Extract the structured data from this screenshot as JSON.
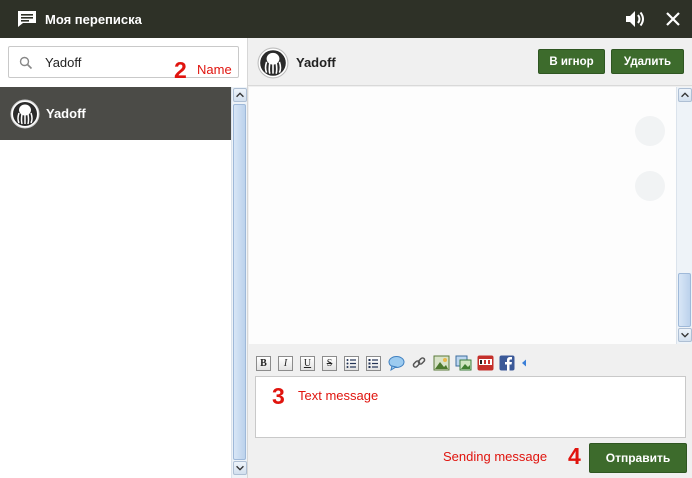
{
  "titlebar": {
    "title": "Моя переписка",
    "icons": [
      "chat-icon",
      "speaker-icon",
      "close-icon"
    ]
  },
  "search": {
    "value": "Yadoff"
  },
  "annotations": {
    "name_num": "2",
    "name_text": "Name",
    "text_num": "3",
    "text_text": "Text message",
    "send_num": "4",
    "send_text": "Sending message"
  },
  "contacts": [
    {
      "name": "Yadoff",
      "selected": true
    }
  ],
  "conversation": {
    "name": "Yadoff",
    "ignore_label": "В игнор",
    "delete_label": "Удалить",
    "send_label": "Отправить"
  },
  "toolbar": {
    "bold": "B",
    "italic": "I",
    "underline": "U",
    "strike": "S",
    "items": [
      "bold-icon",
      "italic-icon",
      "underline-icon",
      "strikethrough-icon",
      "bullet-list-icon",
      "numbered-list-icon",
      "speech-bubble-icon",
      "link-icon",
      "image-icon",
      "gallery-icon",
      "youtube-icon",
      "facebook-icon",
      "collapse-arrow-icon"
    ]
  },
  "colors": {
    "titlebar": "#2e3127",
    "contact_selected": "#4b4b47",
    "button_green": "#3d6b2c",
    "annotation": "#e0140e"
  }
}
